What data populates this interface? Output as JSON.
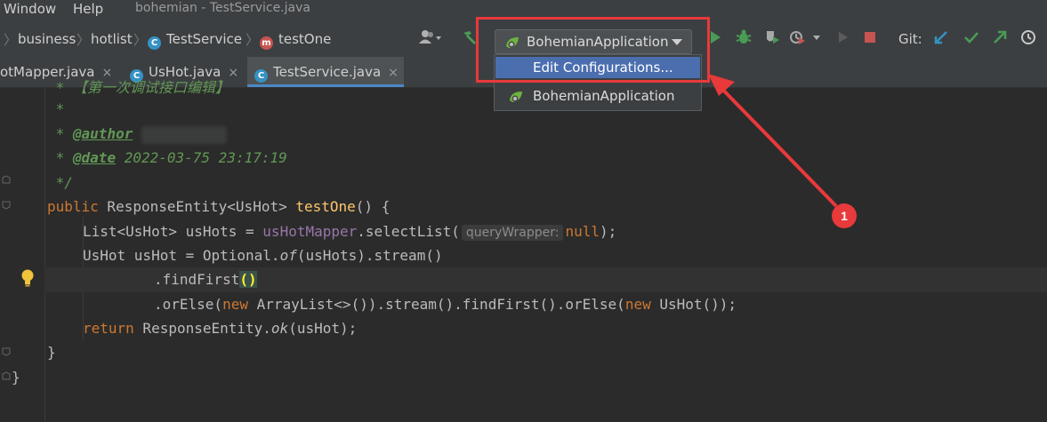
{
  "menubar": {
    "items": [
      "Window",
      "Help"
    ],
    "window_title": "bohemian - TestService.java"
  },
  "breadcrumb": {
    "items": [
      "business",
      "hotlist",
      "TestService",
      "testOne"
    ]
  },
  "toolbar": {
    "run_config": "BohemianApplication",
    "git_label": "Git:"
  },
  "dropdown": {
    "items": [
      "Edit Configurations...",
      "BohemianApplication"
    ]
  },
  "tabs": [
    {
      "label": "otMapper.java"
    },
    {
      "label": "UsHot.java"
    },
    {
      "label": "TestService.java"
    }
  ],
  "tab_close": "×",
  "code": {
    "l0": " * 【第一次调试接口编辑】",
    "l1": " *",
    "l2_pre": " * ",
    "l2_tag": "@author",
    "l3_pre": " * ",
    "l3_tag": "@date",
    "l3_text": " 2022-03-75 23:17:19",
    "l4": " */",
    "l5_kw": "public",
    "l5_a": " ResponseEntity<UsHot> ",
    "l5_fn": "testOne",
    "l5_b": "() {",
    "l6_a": "List<UsHot> usHots = ",
    "l6_fld": "usHotMapper",
    "l6_b": ".selectList(",
    "l6_hint": "queryWrapper:",
    "l6_kw": "null",
    "l6_c": ");",
    "l7_a": "UsHot usHot = Optional.",
    "l7_it": "of",
    "l7_b": "(usHots).stream()",
    "l8_a": ".findFirst",
    "l8_paren": "()",
    "l9_a": ".orElse(",
    "l9_kw1": "new",
    "l9_b": " ArrayList<>()).stream().findFirst().orElse(",
    "l9_kw2": "new",
    "l9_c": " UsHot());",
    "l10_kw": "return",
    "l10_a": " ResponseEntity.",
    "l10_it": "ok",
    "l10_b": "(usHot);",
    "l11": "}",
    "l12": "}"
  },
  "annotation": {
    "badge": "1"
  },
  "colors": {
    "accent_red": "#e8393b",
    "selection_blue": "#4b6eaf",
    "keyword": "#cc7832",
    "method": "#ffc66d",
    "comment": "#629755"
  }
}
